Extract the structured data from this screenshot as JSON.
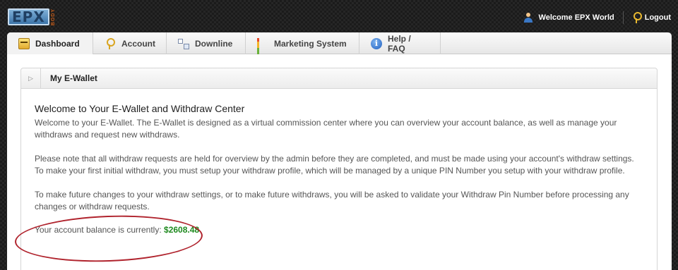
{
  "header": {
    "logo_text": "EPX",
    "logo_sub": "BODY",
    "welcome_text": "Welcome EPX World",
    "logout_label": "Logout"
  },
  "tabs": [
    {
      "label": "Dashboard",
      "icon": "dashboard-icon",
      "active": true
    },
    {
      "label": "Account",
      "icon": "key-icon"
    },
    {
      "label": "Downline",
      "icon": "tree-icon"
    },
    {
      "label": "Marketing System",
      "icon": "bar-chart-icon"
    },
    {
      "label": "Help / FAQ",
      "icon": "info-icon"
    }
  ],
  "panel": {
    "title": "My E-Wallet",
    "heading": "Welcome to Your E-Wallet and Withdraw Center",
    "paragraphs": [
      "Welcome to your E-Wallet. The E-Wallet is designed as a virtual commission center where you can overview your account balance, as well as manage your withdraws and request new withdraws.",
      "Please note that all withdraw requests are held for overview by the admin before they are completed, and must be made using your account's withdraw settings. To make your first initial withdraw, you must setup your withdraw profile, which will be managed by a unique PIN Number you setup with your withdraw profile.",
      "To make future changes to your withdraw settings, or to make future withdraws, you will be asked to validate your Withdraw Pin Number before processing any changes or withdraw requests."
    ],
    "balance_label": "Your account balance is currently:",
    "balance_value": "$2608.48"
  },
  "colors": {
    "balance_green": "#1f8a1f",
    "annotation_red": "#b0232d"
  }
}
